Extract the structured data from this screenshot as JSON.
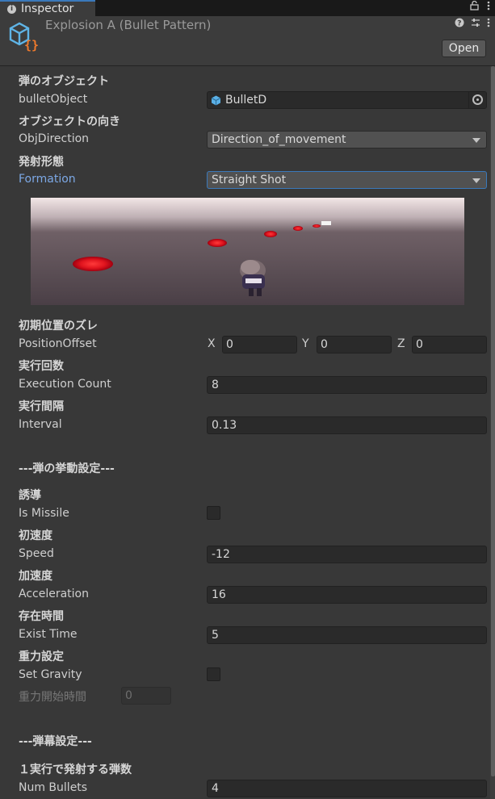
{
  "tab": {
    "label": "Inspector"
  },
  "header": {
    "title": "Explosion A (Bullet Pattern)",
    "open_label": "Open"
  },
  "fields": {
    "bullet_object": {
      "header": "弾のオブジェクト",
      "label": "bulletObject",
      "value": "BulletD"
    },
    "obj_direction": {
      "header": "オブジェクトの向き",
      "label": "ObjDirection",
      "value": "Direction_of_movement"
    },
    "formation": {
      "header": "発射形態",
      "label": "Formation",
      "value": "Straight Shot"
    },
    "position_offset": {
      "header": "初期位置のズレ",
      "label": "PositionOffset",
      "x_label": "X",
      "x": "0",
      "y_label": "Y",
      "y": "0",
      "z_label": "Z",
      "z": "0"
    },
    "execution_count": {
      "header": "実行回数",
      "label": "Execution Count",
      "value": "8"
    },
    "interval": {
      "header": "実行間隔",
      "label": "Interval",
      "value": "0.13"
    },
    "behavior_section": "---弾の挙動設定---",
    "is_missile": {
      "header": "誘導",
      "label": "Is Missile",
      "checked": false
    },
    "speed": {
      "header": "初速度",
      "label": "Speed",
      "value": "-12"
    },
    "acceleration": {
      "header": "加速度",
      "label": "Acceleration",
      "value": "16"
    },
    "exist_time": {
      "header": "存在時間",
      "label": "Exist Time",
      "value": "5"
    },
    "set_gravity": {
      "header": "重力設定",
      "label": "Set Gravity",
      "checked": false
    },
    "gravity_start": {
      "label": "重力開始時間",
      "value": "0"
    },
    "barrage_section": "---弾幕設定---",
    "num_bullets": {
      "header": "１実行で発射する弾数",
      "label": "Num Bullets",
      "value": "4"
    }
  },
  "colors": {
    "accent": "#3a79bb",
    "active_label": "#7ca8e5",
    "background": "#383838",
    "bullet": "#e0141e"
  },
  "icons": [
    "info-icon",
    "lock-icon",
    "menu-icon",
    "help-icon",
    "settings-icon",
    "script-cube-icon",
    "prefab-cube-icon",
    "object-picker-icon",
    "chevron-down-icon"
  ]
}
